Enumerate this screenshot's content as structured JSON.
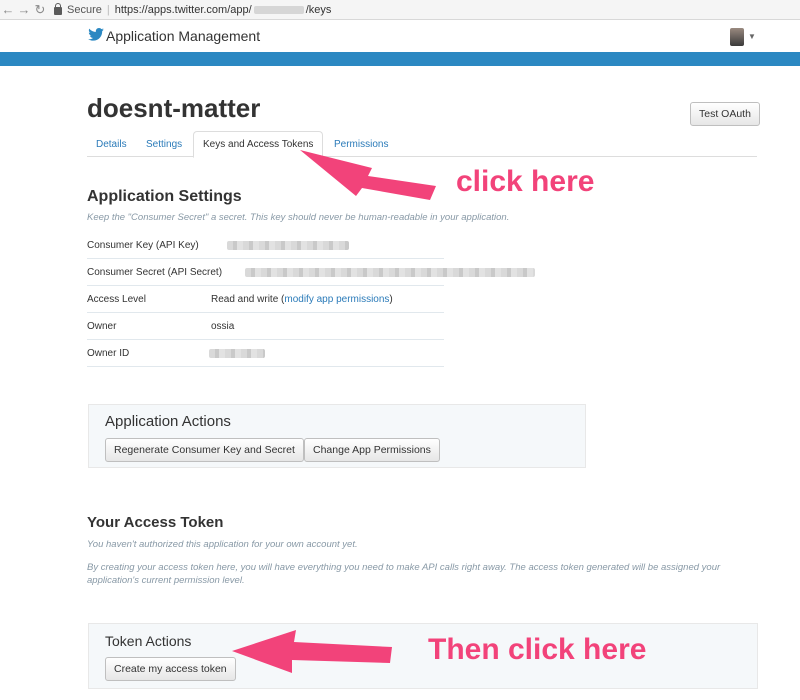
{
  "browser": {
    "secure_label": "Secure",
    "url_prefix": "https://apps.twitter.com/app/",
    "url_suffix": "/keys"
  },
  "header": {
    "title": "Application Management",
    "brand_color": "#2b88c2"
  },
  "page": {
    "title": "doesnt-matter",
    "test_oauth_label": "Test OAuth"
  },
  "tabs": [
    {
      "label": "Details"
    },
    {
      "label": "Settings"
    },
    {
      "label": "Keys and Access Tokens",
      "active": true
    },
    {
      "label": "Permissions"
    }
  ],
  "app_settings": {
    "heading": "Application Settings",
    "note": "Keep the \"Consumer Secret\" a secret. This key should never be human-readable in your application.",
    "rows": [
      {
        "label": "Consumer Key (API Key)",
        "value": ""
      },
      {
        "label": "Consumer Secret (API Secret)",
        "value": ""
      },
      {
        "label": "Access Level",
        "value": "Read and write (",
        "link": "modify app permissions",
        "value_after": ")"
      },
      {
        "label": "Owner",
        "value": "ossia"
      },
      {
        "label": "Owner ID",
        "value": ""
      }
    ]
  },
  "app_actions": {
    "heading": "Application Actions",
    "regenerate_label": "Regenerate Consumer Key and Secret",
    "change_perms_label": "Change App Permissions"
  },
  "access_token": {
    "heading": "Your Access Token",
    "note1": "You haven't authorized this application for your own account yet.",
    "note2": "By creating your access token here, you will have everything you need to make API calls right away. The access token generated will be assigned your application's current permission level."
  },
  "token_actions": {
    "heading": "Token Actions",
    "create_label": "Create my access token"
  },
  "annotations": {
    "first": "click here",
    "second": "Then click here",
    "color": "#f2437a"
  }
}
